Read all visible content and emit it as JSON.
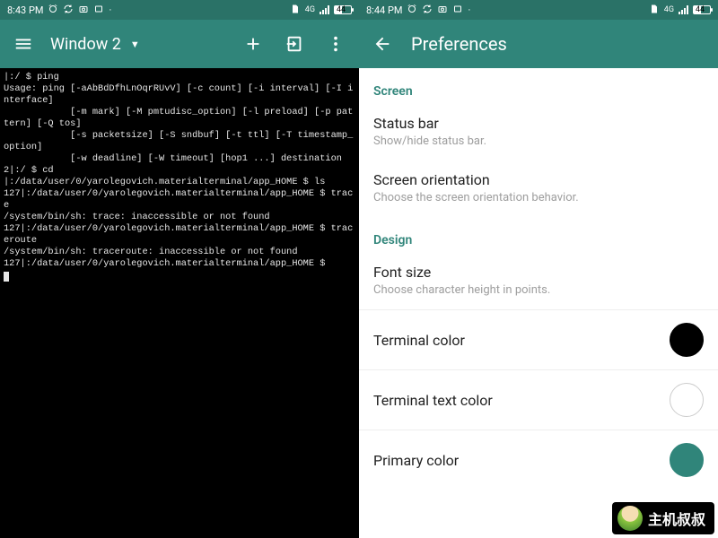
{
  "left": {
    "status": {
      "time": "8:43 PM",
      "net_label": "4G",
      "battery_pct": "44"
    },
    "appbar": {
      "title": "Window 2"
    },
    "terminal_lines": [
      "|:/ $ ping",
      "Usage: ping [-aAbBdDfhLnOqrRUvV] [-c count] [-i interval] [-I interface]",
      "            [-m mark] [-M pmtudisc_option] [-l preload] [-p pattern] [-Q tos]",
      "            [-s packetsize] [-S sndbuf] [-t ttl] [-T timestamp_option]",
      "            [-w deadline] [-W timeout] [hop1 ...] destination",
      "2|:/ $ cd",
      "|:/data/user/0/yarolegovich.materialterminal/app_HOME $ ls",
      "127|:/data/user/0/yarolegovich.materialterminal/app_HOME $ trace",
      "/system/bin/sh: trace: inaccessible or not found",
      "127|:/data/user/0/yarolegovich.materialterminal/app_HOME $ traceroute",
      "/system/bin/sh: traceroute: inaccessible or not found",
      "127|:/data/user/0/yarolegovich.materialterminal/app_HOME $"
    ]
  },
  "right": {
    "status": {
      "time": "8:44 PM",
      "net_label": "4G",
      "battery_pct": "44"
    },
    "appbar": {
      "title": "Preferences"
    },
    "sections": {
      "screen": {
        "header": "Screen",
        "status_bar": {
          "title": "Status bar",
          "sub": "Show/hide status bar."
        },
        "orientation": {
          "title": "Screen orientation",
          "sub": "Choose the screen orientation behavior."
        }
      },
      "design": {
        "header": "Design",
        "font_size": {
          "title": "Font size",
          "sub": "Choose character height in points."
        },
        "term_color": {
          "title": "Terminal color",
          "value": "#000000"
        },
        "term_text_color": {
          "title": "Terminal text color",
          "value": "#ffffff"
        },
        "primary_color": {
          "title": "Primary color",
          "value": "#30857a"
        }
      }
    }
  },
  "brand": {
    "text": "主机叔叔"
  }
}
